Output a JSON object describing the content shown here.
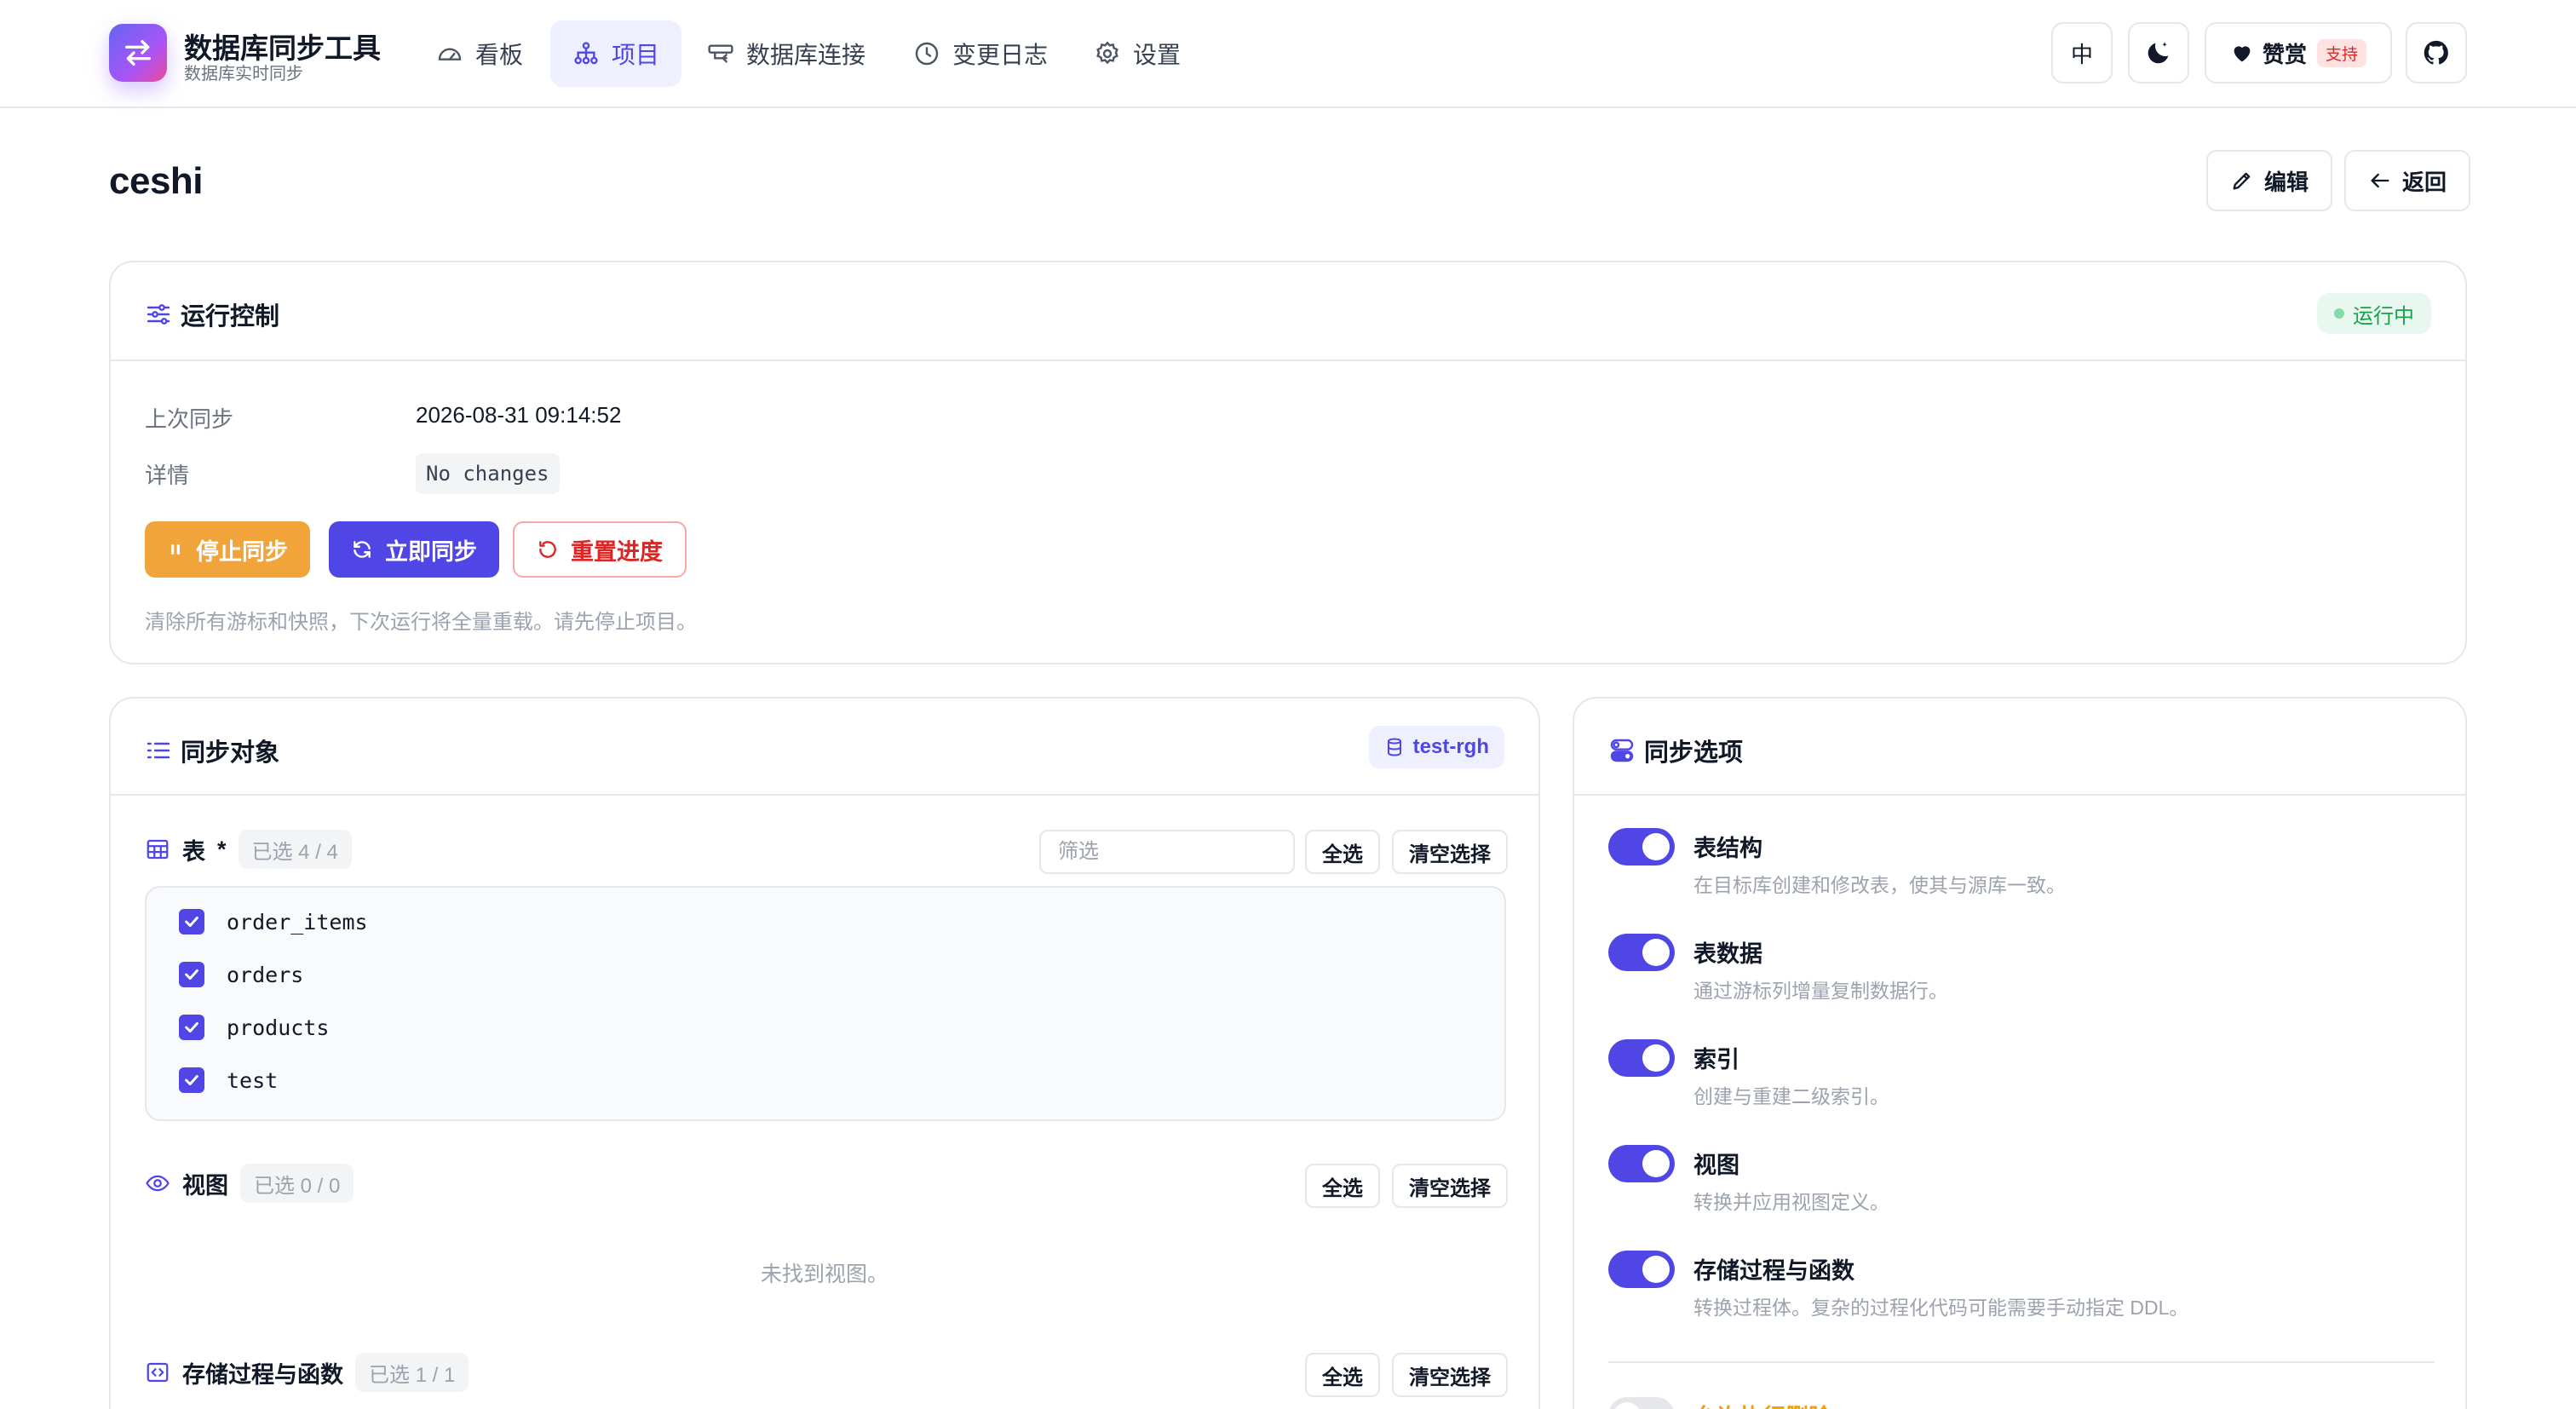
{
  "app": {
    "title": "数据库同步工具",
    "subtitle": "数据库实时同步"
  },
  "nav": [
    {
      "label": "看板",
      "icon": "dashboard-icon"
    },
    {
      "label": "项目",
      "icon": "project-icon",
      "active": true
    },
    {
      "label": "数据库连接",
      "icon": "connection-icon"
    },
    {
      "label": "变更日志",
      "icon": "clock-icon"
    },
    {
      "label": "设置",
      "icon": "gear-icon"
    }
  ],
  "header_actions": {
    "lang": "中",
    "sponsor": "赞赏",
    "sponsor_badge": "支持"
  },
  "page": {
    "title": "ceshi",
    "edit_label": "编辑",
    "back_label": "返回"
  },
  "run_control": {
    "title": "运行控制",
    "status": "运行中",
    "last_sync_label": "上次同步",
    "last_sync_value": "2026-08-31 09:14:52",
    "detail_label": "详情",
    "detail_value": "No changes",
    "stop_label": "停止同步",
    "sync_label": "立即同步",
    "reset_label": "重置进度",
    "hint": "清除所有游标和快照，下次运行将全量重载。请先停止项目。"
  },
  "sync_objects": {
    "title": "同步对象",
    "database": "test-rgh",
    "tables": {
      "label": "表",
      "required_mark": "*",
      "count": "已选 4 / 4",
      "filter_placeholder": "筛选",
      "select_all": "全选",
      "clear": "清空选择",
      "items": [
        "order_items",
        "orders",
        "products",
        "test"
      ]
    },
    "views": {
      "label": "视图",
      "count": "已选 0 / 0",
      "select_all": "全选",
      "clear": "清空选择",
      "empty": "未找到视图。"
    },
    "routines": {
      "label": "存储过程与函数",
      "count": "已选 1 / 1",
      "select_all": "全选",
      "clear": "清空选择"
    }
  },
  "sync_options": {
    "title": "同步选项",
    "items": [
      {
        "title": "表结构",
        "desc": "在目标库创建和修改表，使其与源库一致。",
        "enabled": true
      },
      {
        "title": "表数据",
        "desc": "通过游标列增量复制数据行。",
        "enabled": true
      },
      {
        "title": "索引",
        "desc": "创建与重建二级索引。",
        "enabled": true
      },
      {
        "title": "视图",
        "desc": "转换并应用视图定义。",
        "enabled": true
      },
      {
        "title": "存储过程与函数",
        "desc": "转换过程体。复杂的过程化代码可能需要手动指定 DDL。",
        "enabled": true
      }
    ],
    "danger": {
      "title": "允许执行删除",
      "enabled": false
    }
  },
  "colors": {
    "accent": "#4f46e5",
    "warning": "#f0a43a",
    "danger": "#dc2626",
    "success": "#16a34a"
  }
}
